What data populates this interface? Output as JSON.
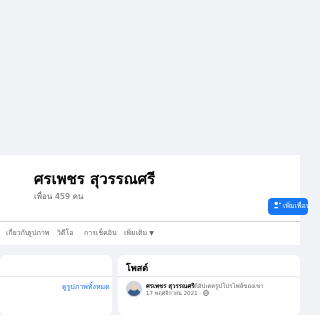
{
  "profile": {
    "name": "ศรเพชร สุวรรณศรี",
    "friends_count": "เพื่อน 459 คน",
    "follow_label": "เพิ่มเพื่อน"
  },
  "tabs": [
    {
      "label": "เกี่ยวกับ"
    },
    {
      "label": "รูปภาพ"
    },
    {
      "label": "วิดีโอ"
    },
    {
      "label": "การเช็คอิน"
    },
    {
      "label": "เพิ่มเติม"
    }
  ],
  "sidebar_card": {
    "all_photos_label": "ดูรูปภาพทั้งหมด"
  },
  "posts": {
    "title": "โพสต์",
    "items": [
      {
        "author": "ศรเพชร สุวรรณศรี",
        "action": "ได้อัปเดตรูปโปรไฟล์ของเขา",
        "date": "17 พฤศจิกายน 2021 ·"
      }
    ]
  },
  "colors": {
    "accent": "#1877f2",
    "background": "#f0f2f5",
    "muted_text": "#65676b"
  },
  "icons": {
    "follow": "add-friend-icon",
    "more_chevron": "chevron-down-icon",
    "privacy": "globe-icon"
  }
}
